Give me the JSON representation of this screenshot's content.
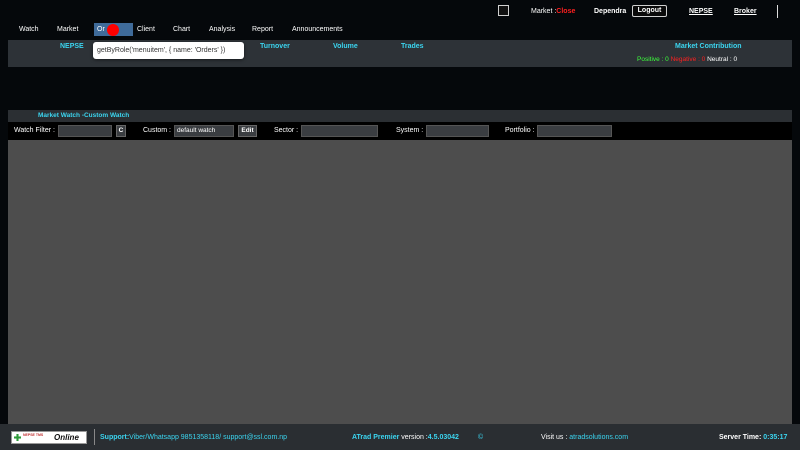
{
  "topbar": {
    "market_label": "Market :",
    "market_status": "Close",
    "user_name": "Dependra",
    "logout_label": "Logout",
    "nepse_link": "NEPSE",
    "broker_link": "Broker"
  },
  "menu": {
    "items": [
      "Watch",
      "Market",
      "Or",
      "Client",
      "Chart",
      "Analysis",
      "Report",
      "Announcements"
    ],
    "active_index": 2,
    "tooltip": "getByRole('menuitem', { name: 'Orders' })"
  },
  "index_strip": {
    "headers": [
      "NEPSE",
      "Turnover",
      "Volume",
      "Trades"
    ],
    "market_contribution_title": "Market Contribution",
    "positive_label": "Positive : 0",
    "negative_label": "Negative : 0",
    "neutral_label": "Neutral : 0"
  },
  "market_watch": {
    "title": "Market Watch -Custom Watch",
    "watch_filter_label": "Watch Filter :",
    "watch_filter_value": "",
    "clear_button": "C",
    "custom_label": "Custom :",
    "custom_value": "default watch",
    "edit_button": "Edit",
    "sector_label": "Sector :",
    "system_label": "System :",
    "portfolio_label": "Portfolio :"
  },
  "footer": {
    "logo_small_text": "NEPSE TMS",
    "logo_status": "Online",
    "support_label": "Support:",
    "support_text": "Viber/Whatsapp 9851358118/ support@ssl.com.np",
    "product_name": "ATrad Premier",
    "version_label": "version :",
    "version_value": "4.5.03042",
    "copyright": "©",
    "visit_label": "Visit us :",
    "visit_url": "atradsolutions.com",
    "server_time_label": "Server Time:",
    "server_time_value": "0:35:17"
  },
  "colors": {
    "accent_cyan": "#3bd5f0",
    "status_red": "#ff2020",
    "positive_green": "#3cff3c",
    "active_menu": "#3f6b9a",
    "grid_bg": "#4d4d4d"
  }
}
